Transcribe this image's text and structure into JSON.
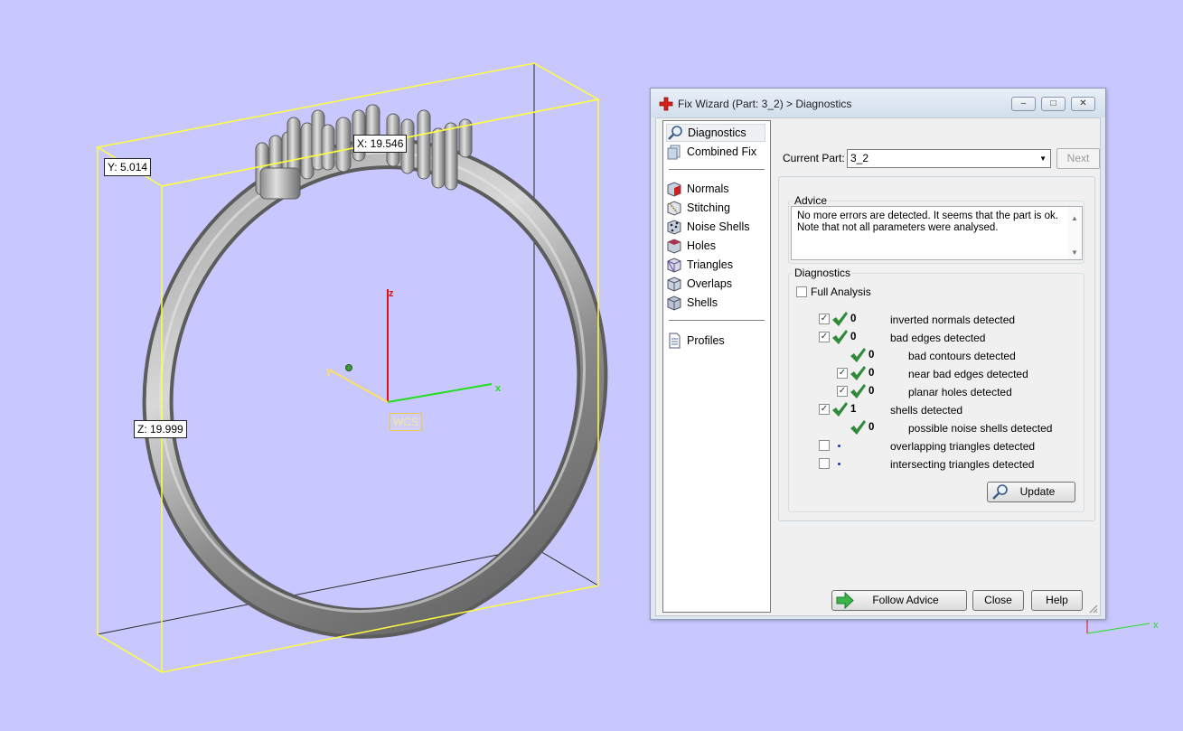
{
  "viewport": {
    "dimensions": {
      "x_label": "X: 19.546",
      "y_label": "Y: 5.014",
      "z_label": "Z: 19.999"
    },
    "wcs_label": "WCS",
    "axes": {
      "x": "x",
      "y": "y",
      "z": "z"
    },
    "colors": {
      "background": "#c8c8ff",
      "bounding_box": "#ffff40",
      "x_axis": "#22dd22",
      "y_axis": "#ffe060",
      "z_axis": "#dd1111"
    }
  },
  "dialog": {
    "title": "Fix Wizard (Part: 3_2) > Diagnostics",
    "window_buttons": {
      "minimize": "–",
      "maximize": "□",
      "close": "✕"
    },
    "nav": {
      "top_items": [
        {
          "label": "Diagnostics",
          "icon": "magnifier-icon",
          "selected": true
        },
        {
          "label": "Combined Fix",
          "icon": "combined-fix-icon"
        }
      ],
      "fix_items": [
        {
          "label": "Normals",
          "icon": "normals-icon"
        },
        {
          "label": "Stitching",
          "icon": "stitching-icon"
        },
        {
          "label": "Noise Shells",
          "icon": "noise-shells-icon"
        },
        {
          "label": "Holes",
          "icon": "holes-icon"
        },
        {
          "label": "Triangles",
          "icon": "triangles-icon"
        },
        {
          "label": "Overlaps",
          "icon": "overlaps-icon"
        },
        {
          "label": "Shells",
          "icon": "shells-icon"
        }
      ],
      "bottom_items": [
        {
          "label": "Profiles",
          "icon": "profiles-icon"
        }
      ]
    },
    "current_part": {
      "label": "Current Part:",
      "value": "3_2"
    },
    "next_button": "Next",
    "advice": {
      "title": "Advice",
      "line1": "No more errors are detected. It seems that the part is ok.",
      "line2": "Note that not all parameters were analysed."
    },
    "diagnostics": {
      "title": "Diagnostics",
      "full_analysis_label": "Full Analysis",
      "full_analysis_checked": false,
      "rows": [
        {
          "checked": true,
          "status": "ok",
          "count": "0",
          "label": "inverted normals detected",
          "indent": 0
        },
        {
          "checked": true,
          "status": "ok",
          "count": "0",
          "label": "bad edges detected",
          "indent": 0
        },
        {
          "checked": null,
          "status": "ok",
          "count": "0",
          "label": "bad contours detected",
          "indent": 1
        },
        {
          "checked": true,
          "status": "ok",
          "count": "0",
          "label": "near bad edges detected",
          "indent": 1
        },
        {
          "checked": true,
          "status": "ok",
          "count": "0",
          "label": "planar holes detected",
          "indent": 1
        },
        {
          "checked": true,
          "status": "ok",
          "count": "1",
          "label": "shells detected",
          "indent": 0
        },
        {
          "checked": null,
          "status": "ok",
          "count": "0",
          "label": "possible noise shells detected",
          "indent": 1
        },
        {
          "checked": false,
          "status": "pending",
          "count": "",
          "label": "overlapping triangles detected",
          "indent": 0
        },
        {
          "checked": false,
          "status": "pending",
          "count": "",
          "label": "intersecting triangles detected",
          "indent": 0
        }
      ],
      "update_button": "Update"
    },
    "footer": {
      "follow_advice": "Follow Advice",
      "close": "Close",
      "help": "Help"
    }
  }
}
